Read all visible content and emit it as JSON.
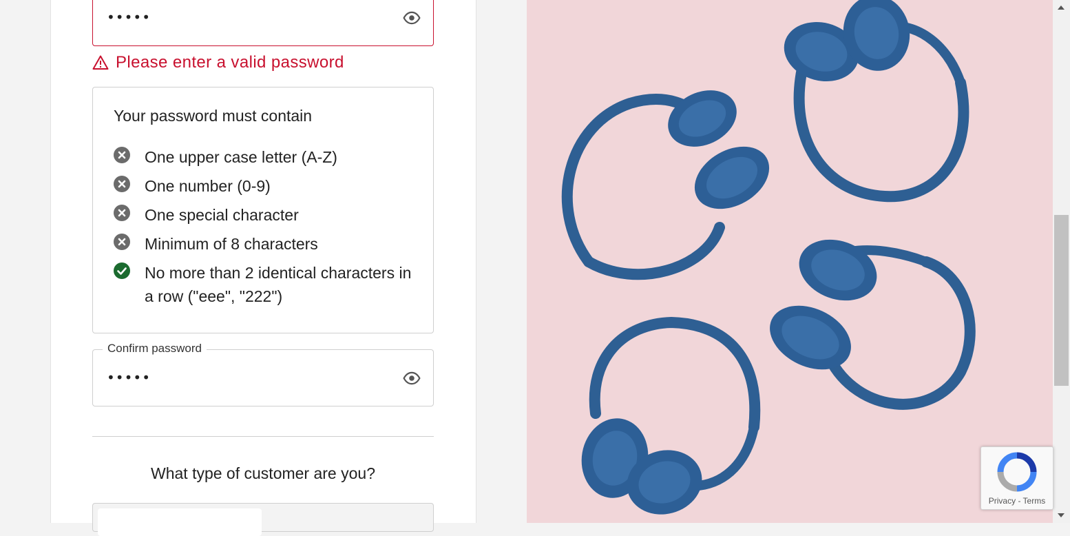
{
  "password_field": {
    "masked_value": "•••••",
    "error": "Please enter a valid password"
  },
  "requirements": {
    "title": "Your password must contain",
    "items": [
      {
        "label": "One upper case letter (A-Z)",
        "status": "unmet"
      },
      {
        "label": "One number (0-9)",
        "status": "unmet"
      },
      {
        "label": "One special character",
        "status": "unmet"
      },
      {
        "label": "Minimum of 8 characters",
        "status": "unmet"
      },
      {
        "label": "No more than 2 identical characters in a row (\"eee\", \"222\")",
        "status": "met"
      }
    ]
  },
  "confirm_password": {
    "label": "Confirm password",
    "masked_value": "•••••"
  },
  "customer_type": {
    "question": "What type of customer are you?"
  },
  "recaptcha": {
    "footer": "Privacy - Terms"
  },
  "colors": {
    "error": "#c8102e",
    "met": "#1b6b2f",
    "unmet": "#6b6b6b",
    "photo_background": "#f1d6d9",
    "headphone_blue": "#2e5f93"
  },
  "icons": {
    "warning": "warning-triangle-icon",
    "show_password": "eye-icon",
    "unmet": "x-circle-icon",
    "met": "check-circle-icon"
  }
}
